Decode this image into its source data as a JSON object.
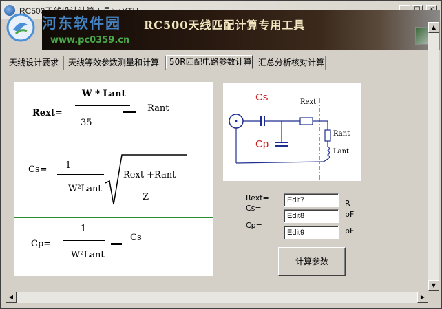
{
  "window": {
    "title": "RC500天线设计计算工具by YTH",
    "minimize_glyph": "_",
    "maximize_glyph": "□",
    "close_glyph": "×"
  },
  "banner": {
    "title": "RC500天线匹配计算专用工具",
    "watermark_name": "河东软件园",
    "watermark_url": "www.pc0359.cn"
  },
  "tabs": [
    {
      "label": "天线设计要求"
    },
    {
      "label": "天线等效参数测量和计算"
    },
    {
      "label": "50R匹配电路参数计算",
      "active": true
    },
    {
      "label": "汇总分析核对计算"
    }
  ],
  "formulas": {
    "rext": {
      "lhs": "Rext=",
      "num": "W * Lant",
      "den": "35",
      "rhs": "Rant"
    },
    "cs": {
      "lhs": "Cs=",
      "num": "1",
      "den": "W²Lant",
      "sqrt_num": "Rext +Rant",
      "sqrt_den": "Z"
    },
    "cp": {
      "lhs": "Cp=",
      "num": "1",
      "den": "W²Lant",
      "rhs": "Cs"
    }
  },
  "circuit": {
    "cs_label": "Cs",
    "cp_label": "Cp",
    "rext_label": "Rext",
    "rant_label": "Rant",
    "lant_label": "Lant"
  },
  "fields": {
    "rext_label": "Rext=",
    "cs_label": "Cs=",
    "cp_label": "Cp=",
    "edit7": "Edit7",
    "edit8": "Edit8",
    "edit9": "Edit9",
    "unit_r": "R",
    "unit_pf1": "pF",
    "unit_pf2": "pF"
  },
  "calc_button": "计算参数",
  "scrollbars": {
    "up": "▲",
    "down": "▼",
    "left": "◀",
    "right": "▶"
  },
  "colors": {
    "accent_red": "#cc2222",
    "divider_green": "#2e8b2e",
    "circuit_blue": "#1f2f8f",
    "circuit_red": "#c81e1e"
  }
}
